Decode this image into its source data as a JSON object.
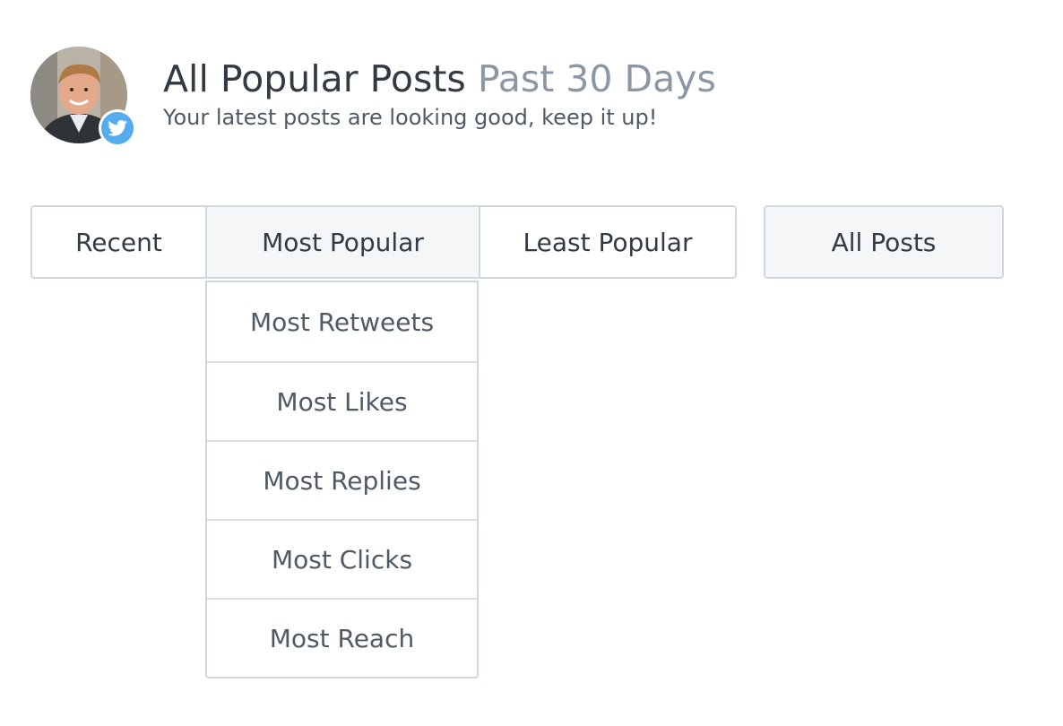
{
  "header": {
    "title": "All Popular Posts",
    "range": "Past 30 Days",
    "subtitle": "Your latest posts are looking good, keep it up!",
    "network_icon": "twitter-icon",
    "network_color": "#55acee"
  },
  "tabs": [
    {
      "label": "Recent",
      "selected": false
    },
    {
      "label": "Most Popular",
      "selected": true
    },
    {
      "label": "Least Popular",
      "selected": false
    }
  ],
  "filter": {
    "label": "All Posts"
  },
  "dropdown": {
    "items": [
      {
        "label": "Most Retweets"
      },
      {
        "label": "Most Likes"
      },
      {
        "label": "Most Replies"
      },
      {
        "label": "Most Clicks"
      },
      {
        "label": "Most Reach"
      }
    ]
  },
  "colors": {
    "border": "#cfd8e0",
    "active_bg": "#f4f6f8",
    "text_primary": "#323b43",
    "text_muted": "#8b97a4"
  }
}
